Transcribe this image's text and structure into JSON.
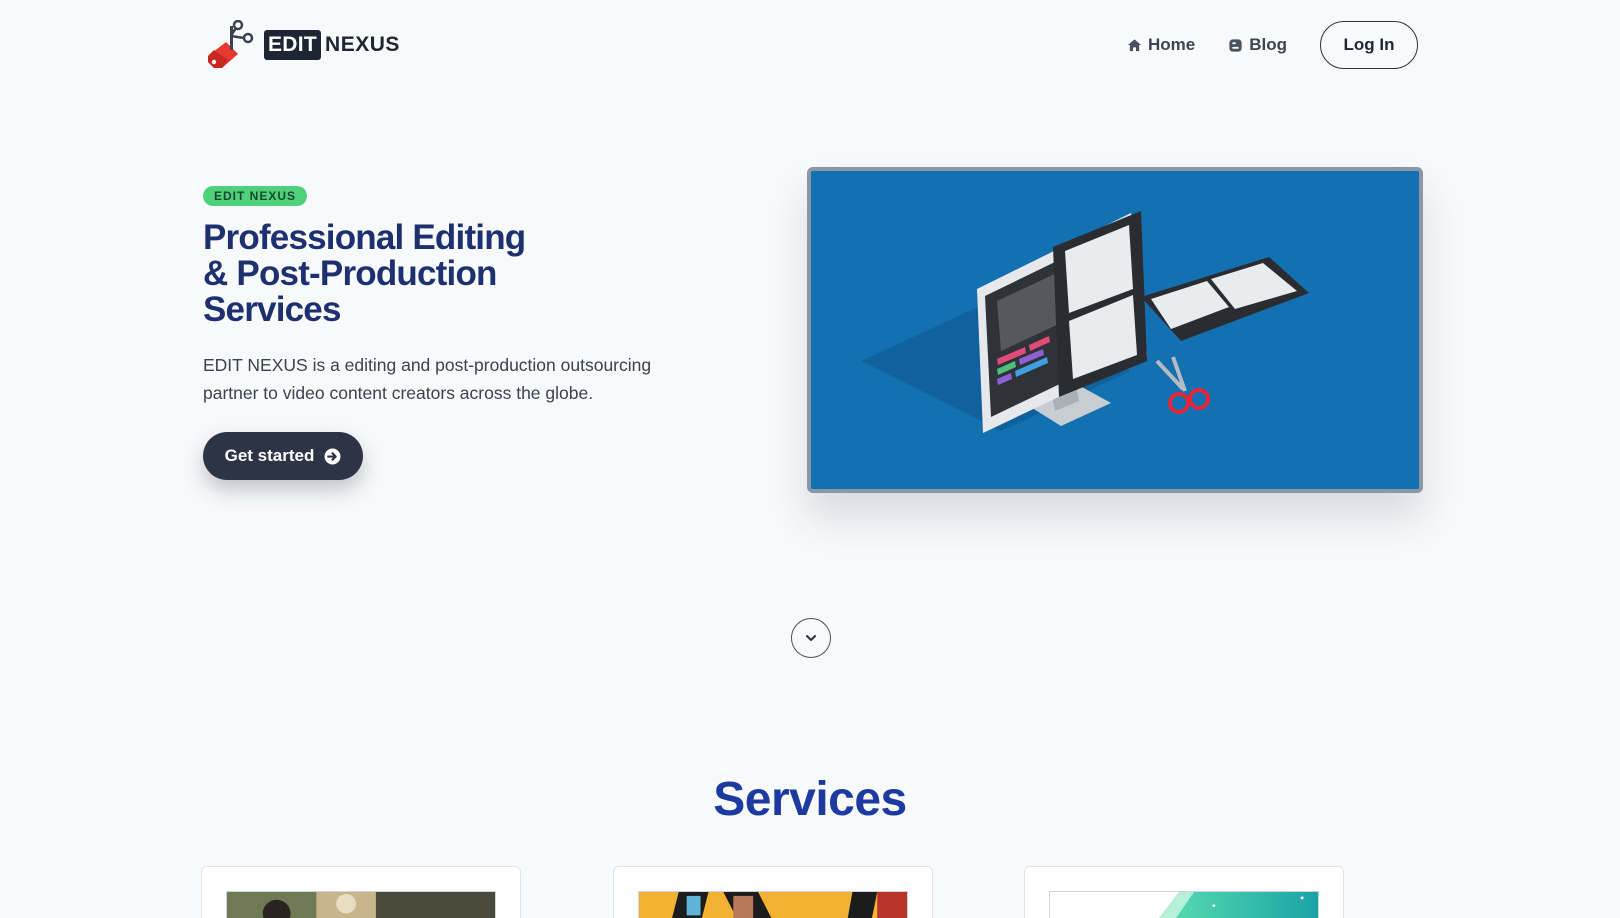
{
  "brand": {
    "edit": "EDIT",
    "nexus": "NEXUS",
    "logo_icon": "scissors-tag-icon"
  },
  "nav": {
    "home_label": "Home",
    "home_icon": "home-icon",
    "blog_label": "Blog",
    "blog_icon": "blogger-icon",
    "login_label": "Log In"
  },
  "hero": {
    "badge": "EDIT NEXUS",
    "title_line1": "Professional Editing",
    "title_line2": "& Post-Production",
    "title_line3": "Services",
    "description": "EDIT NEXUS is a editing and post-production outsourcing partner to video content creators across the globe.",
    "cta_label": "Get started",
    "cta_icon": "arrow-circle-right-icon",
    "illustration": "monitor-filmstrip-scissors-illustration"
  },
  "scroll_icon": "chevron-down-icon",
  "services": {
    "heading": "Services",
    "cards": [
      {
        "thumb": "video-editing-photo"
      },
      {
        "thumb": "filmstrip-collage-photo"
      },
      {
        "thumb": "gradient-graphic"
      }
    ]
  },
  "colors": {
    "background": "#f8f9fb",
    "heading_navy": "#1d3170",
    "services_blue": "#1d3aa0",
    "badge_green": "#4fd17b",
    "button_dark": "#2d3445",
    "hero_blue": "#1371b2"
  }
}
